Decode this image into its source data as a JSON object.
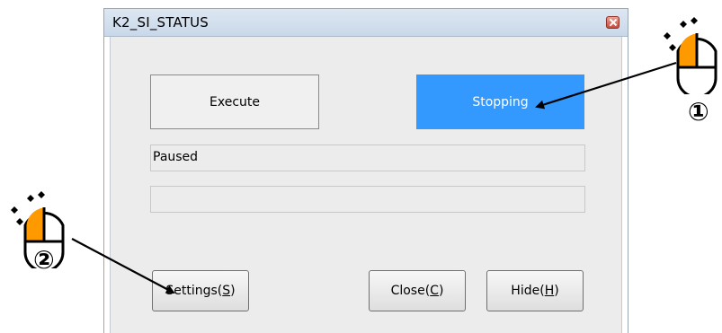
{
  "window": {
    "title": "K2_SI_STATUS"
  },
  "buttons": {
    "execute": "Execute",
    "stopping": "Stopping",
    "settings": {
      "label": "Settings(",
      "mnemonic": "S",
      "suffix": ")"
    },
    "close": {
      "label": "Close(",
      "mnemonic": "C",
      "suffix": ")"
    },
    "hide": {
      "label": "Hide(",
      "mnemonic": "H",
      "suffix": ")"
    }
  },
  "fields": {
    "status": "Paused",
    "progress": ""
  },
  "annotations": {
    "step1": "①",
    "step2": "②"
  },
  "colors": {
    "active_button": "#3399ff",
    "mouse_button_highlight": "#ff9900",
    "arrow": "#000000"
  },
  "icons": [
    "window-close-icon",
    "mouse-icon"
  ]
}
